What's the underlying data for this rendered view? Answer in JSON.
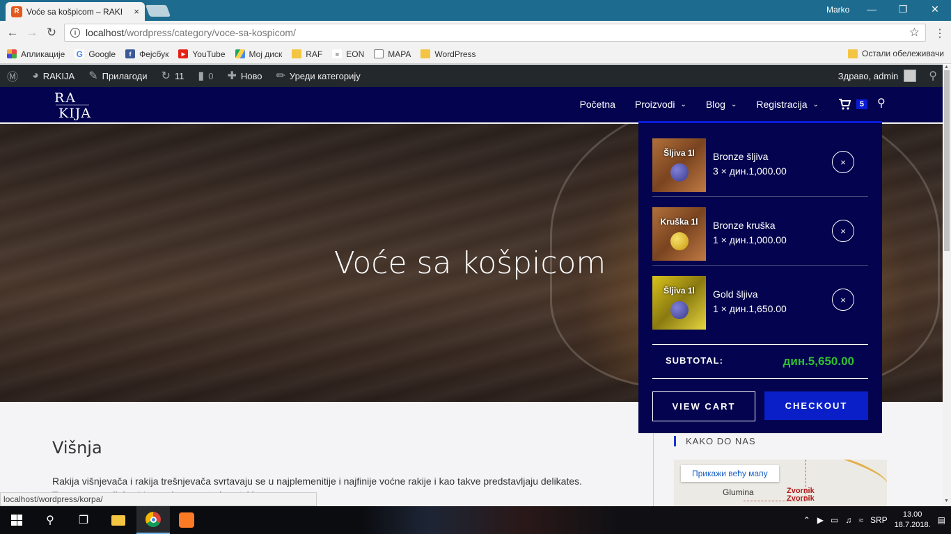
{
  "browser": {
    "tab_title": "Voće sa košpicom – RAKI",
    "tab_close": "×",
    "window_user": "Marko",
    "url_host": "localhost",
    "url_path": "/wordpress/category/voce-sa-kospicom/",
    "status_url": "localhost/wordpress/korpa/"
  },
  "bookmarks": {
    "items": [
      {
        "label": "Апликације",
        "icon": "apps-grid-icon"
      },
      {
        "label": "Google",
        "icon": "google-icon"
      },
      {
        "label": "Фејсбук",
        "icon": "facebook-icon"
      },
      {
        "label": "YouTube",
        "icon": "youtube-icon"
      },
      {
        "label": "Мој диск",
        "icon": "drive-icon"
      },
      {
        "label": "RAF",
        "icon": "folder-icon"
      },
      {
        "label": "EON",
        "icon": "eon-icon"
      },
      {
        "label": "MAPA",
        "icon": "page-icon"
      },
      {
        "label": "WordPress",
        "icon": "folder-icon"
      }
    ],
    "other": "Остали обележивачи"
  },
  "wpbar": {
    "site": "RAKIJA",
    "customize": "Прилагоди",
    "updates": "11",
    "comments": "0",
    "new": "Ново",
    "edit": "Уреди категорију",
    "greeting": "Здраво, admin"
  },
  "site": {
    "logo": "RAKIJA",
    "nav": [
      "Početna",
      "Proizvodi",
      "Blog",
      "Registracija"
    ],
    "cart_count": "5"
  },
  "hero": {
    "title": "Voće sa košpicom"
  },
  "post": {
    "title": "Višnja",
    "excerpt": "Rakija višnjevača i rakija trešnjevača svrtavaju se u  najplemenitije i najfinije voćne rakije i kao takve predstavljaju delikates. Tr...veznye palinka. Veoma je poznata i svetski..."
  },
  "sidebar": {
    "widget_title": "KAKO DO NAS",
    "map_button": "Прикажи већу мапу",
    "map_town1": "Glumina",
    "map_town2a": "Zvornik",
    "map_town2b": "Zvornik"
  },
  "minicart": {
    "items": [
      {
        "thumb": "Šljiva 1l",
        "name": "Bronze šljiva",
        "qty": "3 × дин.1,000.00",
        "style": "bronze",
        "fruit": "plum"
      },
      {
        "thumb": "Kruška 1l",
        "name": "Bronze kruška",
        "qty": "1 × дин.1,000.00",
        "style": "bronze",
        "fruit": "pear"
      },
      {
        "thumb": "Šljiva 1l",
        "name": "Gold šljiva",
        "qty": "1 × дин.1,650.00",
        "style": "gold",
        "fruit": "plum"
      }
    ],
    "remove": "×",
    "subtotal_label": "SUBTOTAL:",
    "subtotal_value": "дин.5,650.00",
    "view_cart": "VIEW CART",
    "checkout": "CHECKOUT"
  },
  "taskbar": {
    "lang": "SRP",
    "time": "13.00",
    "date": "18.7.2018."
  },
  "colors": {
    "site_nav": "#030350",
    "accent": "#0a1bd6",
    "subtotal": "#30c030",
    "wpbar": "#23282d"
  }
}
